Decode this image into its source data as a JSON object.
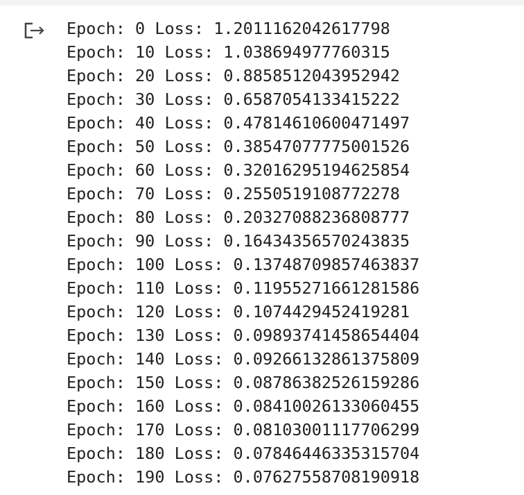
{
  "output": {
    "icon": "output-redirect-icon",
    "lines": [
      "Epoch: 0 Loss: 1.2011162042617798",
      "Epoch: 10 Loss: 1.038694977760315",
      "Epoch: 20 Loss: 0.8858512043952942",
      "Epoch: 30 Loss: 0.6587054133415222",
      "Epoch: 40 Loss: 0.47814610600471497",
      "Epoch: 50 Loss: 0.38547077775001526",
      "Epoch: 60 Loss: 0.32016295194625854",
      "Epoch: 70 Loss: 0.2550519108772278",
      "Epoch: 80 Loss: 0.20327088236808777",
      "Epoch: 90 Loss: 0.16434356570243835",
      "Epoch: 100 Loss: 0.13748709857463837",
      "Epoch: 110 Loss: 0.11955271661281586",
      "Epoch: 120 Loss: 0.1074429452419281",
      "Epoch: 130 Loss: 0.09893741458654404",
      "Epoch: 140 Loss: 0.09266132861375809",
      "Epoch: 150 Loss: 0.08786382526159286",
      "Epoch: 160 Loss: 0.08410026133060455",
      "Epoch: 170 Loss: 0.08103001117706299",
      "Epoch: 180 Loss: 0.07846446335315704",
      "Epoch: 190 Loss: 0.07627558708190918"
    ]
  }
}
